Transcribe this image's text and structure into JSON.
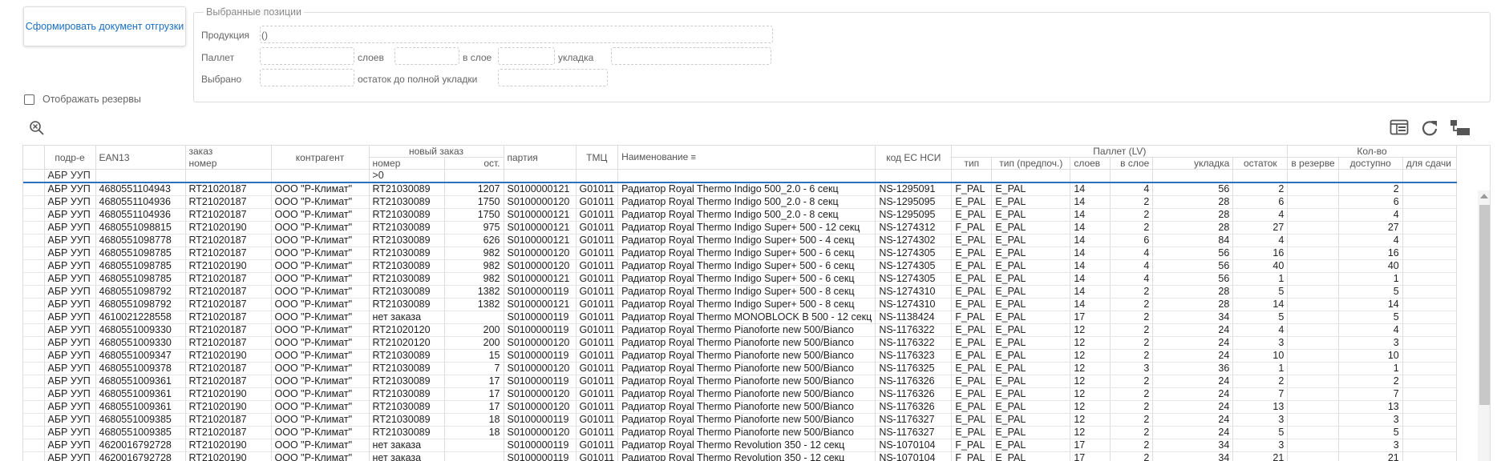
{
  "toolbar": {
    "form_button": "Сформировать документ отгрузки"
  },
  "selected": {
    "legend": "Выбранные позиции",
    "product_label": "Продукция",
    "product_value": "()",
    "pallet_label": "Паллет",
    "layers_label": "слоев",
    "in_layer_label": "в слое",
    "stacking_label": "укладка",
    "chosen_label": "Выбрано",
    "remainder_label": "остаток до полной укладки"
  },
  "reserves": {
    "label": "Отображать резервы",
    "checked": false
  },
  "icons": {
    "clear_filter": "clear-filter-icon",
    "layout": "table-layout-icon",
    "refresh": "refresh-icon",
    "export": "export-icon"
  },
  "grid": {
    "headers": {
      "dept": "подр-е",
      "ean": "EAN13",
      "order": "заказ",
      "order_sub": "номер",
      "contractor": "контрагент",
      "new_order": "новый заказ",
      "new_order_num": "номер",
      "new_order_rest": "ост.",
      "batch": "партия",
      "tmc": "ТМЦ",
      "name": "Наименование",
      "nsi": "код ЕС НСИ",
      "pallet": "Паллет (LV)",
      "type": "тип",
      "type_pref": "тип (предпоч.)",
      "layers": "слоев",
      "in_layer": "в слое",
      "stacking": "укладка",
      "qty": "Кол-во",
      "rest": "остаток",
      "reserve": "в резерве",
      "available": "доступно",
      "to_ship": "для сдачи"
    },
    "filter": {
      "dept": "АБР УУП",
      "new_order_num": ">0"
    },
    "rows": [
      [
        "АБР УУП",
        "4680551104943",
        "RT21020187",
        "ООО \"Р-Климат\"",
        "RT21030089",
        "1207",
        "S0100000121",
        "G01011",
        "Радиатор Royal Thermo Indigo 500_2.0 - 6 секц",
        "NS-1295091",
        "F_PAL",
        "E_PAL",
        "14",
        "4",
        "56",
        "2",
        "",
        "2",
        ""
      ],
      [
        "АБР УУП",
        "4680551104936",
        "RT21020187",
        "ООО \"Р-Климат\"",
        "RT21030089",
        "1750",
        "S0100000120",
        "G01011",
        "Радиатор Royal Thermo Indigo 500_2.0 - 8 секц",
        "NS-1295095",
        "E_PAL",
        "E_PAL",
        "14",
        "2",
        "28",
        "6",
        "",
        "6",
        ""
      ],
      [
        "АБР УУП",
        "4680551104936",
        "RT21020187",
        "ООО \"Р-Климат\"",
        "RT21030089",
        "1750",
        "S0100000121",
        "G01011",
        "Радиатор Royal Thermo Indigo 500_2.0 - 8 секц",
        "NS-1295095",
        "E_PAL",
        "E_PAL",
        "14",
        "2",
        "28",
        "4",
        "",
        "4",
        ""
      ],
      [
        "АБР УУП",
        "4680551098815",
        "RT21020190",
        "ООО \"Р-Климат\"",
        "RT21030089",
        "975",
        "S0100000121",
        "G01011",
        "Радиатор Royal Thermo Indigo Super+ 500 - 12 секц",
        "NS-1274312",
        "F_PAL",
        "E_PAL",
        "14",
        "2",
        "28",
        "27",
        "",
        "27",
        ""
      ],
      [
        "АБР УУП",
        "4680551098778",
        "RT21020187",
        "ООО \"Р-Климат\"",
        "RT21030089",
        "626",
        "S0100000121",
        "G01011",
        "Радиатор Royal Thermo Indigo Super+ 500 - 4 секц",
        "NS-1274302",
        "E_PAL",
        "E_PAL",
        "14",
        "6",
        "84",
        "4",
        "",
        "4",
        ""
      ],
      [
        "АБР УУП",
        "4680551098785",
        "RT21020187",
        "ООО \"Р-Климат\"",
        "RT21030089",
        "982",
        "S0100000120",
        "G01011",
        "Радиатор Royal Thermo Indigo Super+ 500 - 6 секц",
        "NS-1274305",
        "E_PAL",
        "E_PAL",
        "14",
        "4",
        "56",
        "16",
        "",
        "16",
        ""
      ],
      [
        "АБР УУП",
        "4680551098785",
        "RT21020190",
        "ООО \"Р-Климат\"",
        "RT21030089",
        "982",
        "S0100000120",
        "G01011",
        "Радиатор Royal Thermo Indigo Super+ 500 - 6 секц",
        "NS-1274305",
        "E_PAL",
        "E_PAL",
        "14",
        "4",
        "56",
        "40",
        "",
        "40",
        ""
      ],
      [
        "АБР УУП",
        "4680551098785",
        "RT21020187",
        "ООО \"Р-Климат\"",
        "RT21030089",
        "982",
        "S0100000121",
        "G01011",
        "Радиатор Royal Thermo Indigo Super+ 500 - 6 секц",
        "NS-1274305",
        "E_PAL",
        "E_PAL",
        "14",
        "4",
        "56",
        "1",
        "",
        "1",
        ""
      ],
      [
        "АБР УУП",
        "4680551098792",
        "RT21020187",
        "ООО \"Р-Климат\"",
        "RT21030089",
        "1382",
        "S0100000119",
        "G01011",
        "Радиатор Royal Thermo Indigo Super+ 500 - 8 секц",
        "NS-1274310",
        "E_PAL",
        "E_PAL",
        "14",
        "2",
        "28",
        "5",
        "",
        "5",
        ""
      ],
      [
        "АБР УУП",
        "4680551098792",
        "RT21020187",
        "ООО \"Р-Климат\"",
        "RT21030089",
        "1382",
        "S0100000121",
        "G01011",
        "Радиатор Royal Thermo Indigo Super+ 500 - 8 секц",
        "NS-1274310",
        "E_PAL",
        "E_PAL",
        "14",
        "2",
        "28",
        "14",
        "",
        "14",
        ""
      ],
      [
        "АБР УУП",
        "4610021228558",
        "RT21020187",
        "ООО \"Р-Климат\"",
        "нет заказа",
        "",
        "S0100000119",
        "G01011",
        "Радиатор Royal Thermo MONOBLOCK B 500 - 12 секц",
        "NS-1138424",
        "F_PAL",
        "E_PAL",
        "17",
        "2",
        "34",
        "5",
        "",
        "5",
        ""
      ],
      [
        "АБР УУП",
        "4680551009330",
        "RT21020187",
        "ООО \"Р-Климат\"",
        "RT21020120",
        "200",
        "S0100000119",
        "G01011",
        "Радиатор Royal Thermo Pianoforte new 500/Bianco",
        "NS-1176322",
        "E_PAL",
        "E_PAL",
        "12",
        "2",
        "24",
        "4",
        "",
        "4",
        ""
      ],
      [
        "АБР УУП",
        "4680551009330",
        "RT21020187",
        "ООО \"Р-Климат\"",
        "RT21020120",
        "200",
        "S0100000120",
        "G01011",
        "Радиатор Royal Thermo Pianoforte new 500/Bianco",
        "NS-1176322",
        "E_PAL",
        "E_PAL",
        "12",
        "2",
        "24",
        "3",
        "",
        "3",
        ""
      ],
      [
        "АБР УУП",
        "4680551009347",
        "RT21020190",
        "ООО \"Р-Климат\"",
        "RT21030089",
        "15",
        "S0100000119",
        "G01011",
        "Радиатор Royal Thermo Pianoforte new 500/Bianco",
        "NS-1176323",
        "E_PAL",
        "E_PAL",
        "12",
        "2",
        "24",
        "10",
        "",
        "10",
        ""
      ],
      [
        "АБР УУП",
        "4680551009378",
        "RT21020187",
        "ООО \"Р-Климат\"",
        "RT21030089",
        "7",
        "S0100000120",
        "G01011",
        "Радиатор Royal Thermo Pianoforte new 500/Bianco",
        "NS-1176325",
        "E_PAL",
        "E_PAL",
        "12",
        "3",
        "36",
        "1",
        "",
        "1",
        ""
      ],
      [
        "АБР УУП",
        "4680551009361",
        "RT21020187",
        "ООО \"Р-Климат\"",
        "RT21030089",
        "17",
        "S0100000119",
        "G01011",
        "Радиатор Royal Thermo Pianoforte new 500/Bianco",
        "NS-1176326",
        "E_PAL",
        "E_PAL",
        "12",
        "2",
        "24",
        "2",
        "",
        "2",
        ""
      ],
      [
        "АБР УУП",
        "4680551009361",
        "RT21020190",
        "ООО \"Р-Климат\"",
        "RT21030089",
        "17",
        "S0100000120",
        "G01011",
        "Радиатор Royal Thermo Pianoforte new 500/Bianco",
        "NS-1176326",
        "E_PAL",
        "E_PAL",
        "12",
        "2",
        "24",
        "7",
        "",
        "7",
        ""
      ],
      [
        "АБР УУП",
        "4680551009361",
        "RT21020190",
        "ООО \"Р-Климат\"",
        "RT21030089",
        "17",
        "S0100000120",
        "G01011",
        "Радиатор Royal Thermo Pianoforte new 500/Bianco",
        "NS-1176326",
        "E_PAL",
        "E_PAL",
        "12",
        "2",
        "24",
        "13",
        "",
        "13",
        ""
      ],
      [
        "АБР УУП",
        "4680551009385",
        "RT21020187",
        "ООО \"Р-Климат\"",
        "RT21030089",
        "18",
        "S0100000119",
        "G01011",
        "Радиатор Royal Thermo Pianoforte new 500/Bianco",
        "NS-1176327",
        "E_PAL",
        "E_PAL",
        "12",
        "2",
        "24",
        "3",
        "",
        "3",
        ""
      ],
      [
        "АБР УУП",
        "4680551009385",
        "RT21020187",
        "ООО \"Р-Климат\"",
        "RT21030089",
        "18",
        "S0100000120",
        "G01011",
        "Радиатор Royal Thermo Pianoforte new 500/Bianco",
        "NS-1176327",
        "E_PAL",
        "E_PAL",
        "12",
        "2",
        "24",
        "5",
        "",
        "5",
        ""
      ],
      [
        "АБР УУП",
        "4620016792728",
        "RT21020190",
        "ООО \"Р-Климат\"",
        "нет заказа",
        "",
        "S0100000119",
        "G01011",
        "Радиатор Royal Thermo Revolution 350 - 12 секц",
        "NS-1070104",
        "F_PAL",
        "E_PAL",
        "17",
        "2",
        "34",
        "3",
        "",
        "3",
        ""
      ],
      [
        "АБР УУП",
        "4620016792728",
        "RT21020190",
        "ООО \"Р-Климат\"",
        "нет заказа",
        "",
        "S0100000119",
        "G01011",
        "Радиатор Royal Thermo Revolution 350 - 12 секц",
        "NS-1070104",
        "F_PAL",
        "E_PAL",
        "17",
        "2",
        "34",
        "21",
        "",
        "21",
        ""
      ]
    ]
  }
}
